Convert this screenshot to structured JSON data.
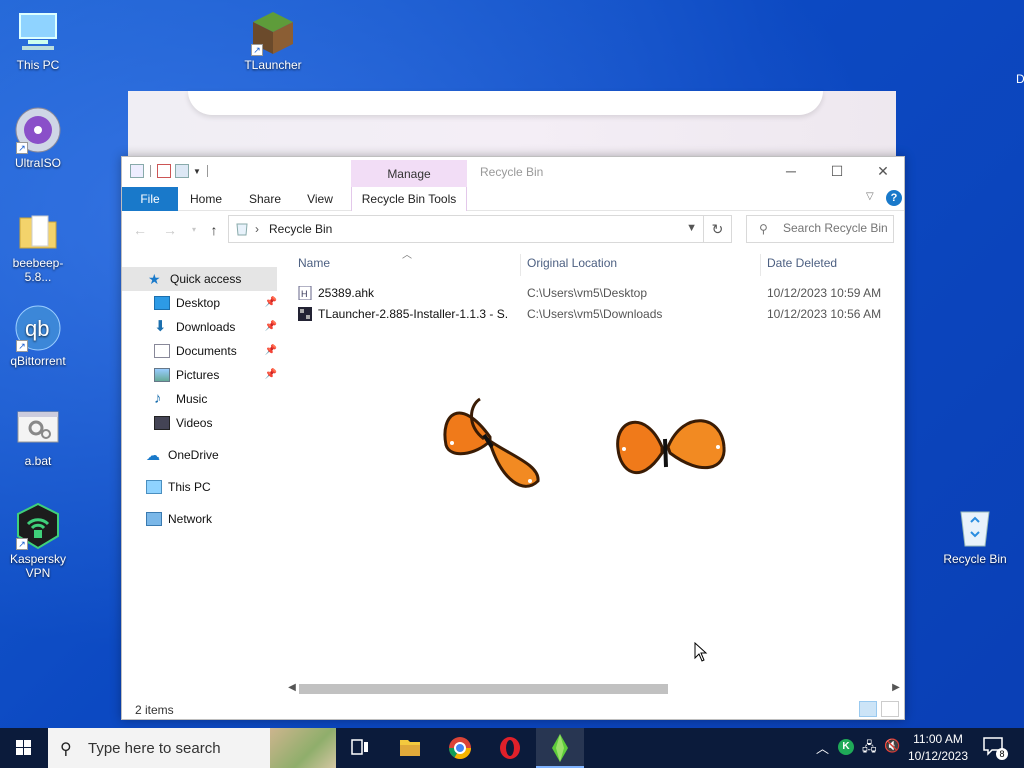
{
  "desktop": {
    "icons": [
      {
        "label": "This PC"
      },
      {
        "label": "TLauncher"
      },
      {
        "label": "UltraISO"
      },
      {
        "label": "beebeep-5.8..."
      },
      {
        "label": "qBittorrent"
      },
      {
        "label": "a.bat"
      },
      {
        "label": "Kaspersky VPN"
      },
      {
        "label": "Recycle Bin"
      }
    ],
    "edge_letter": "D"
  },
  "explorer": {
    "title": "Recycle Bin",
    "contextual_tab_group": "Manage",
    "tabs": [
      "File",
      "Home",
      "Share",
      "View",
      "Recycle Bin Tools"
    ],
    "address": {
      "crumb": "Recycle Bin"
    },
    "search": {
      "placeholder": "Search Recycle Bin"
    },
    "nav": {
      "quick_access": "Quick access",
      "items": [
        "Desktop",
        "Downloads",
        "Documents",
        "Pictures",
        "Music",
        "Videos"
      ],
      "onedrive": "OneDrive",
      "this_pc": "This PC",
      "network": "Network"
    },
    "columns": [
      "Name",
      "Original Location",
      "Date Deleted"
    ],
    "files": [
      {
        "name": "25389.ahk",
        "location": "C:\\Users\\vm5\\Desktop",
        "date": "10/12/2023 10:59 AM",
        "icon": "ahk-script-icon"
      },
      {
        "name": "TLauncher-2.885-Installer-1.1.3 - S...",
        "location": "C:\\Users\\vm5\\Downloads",
        "date": "10/12/2023 10:56 AM",
        "icon": "installer-icon"
      }
    ],
    "status": "2 items",
    "horizontal_scroll": 0.0
  },
  "taskbar": {
    "search_placeholder": "Type here to search",
    "time": "11:00 AM",
    "date": "10/12/2023",
    "notification_count": "8"
  },
  "colors": {
    "accent": "#1979ca",
    "manage_tab": "#f2ddf6",
    "taskbar": "#0b1b3b",
    "butterfly": "#f07a1a"
  }
}
